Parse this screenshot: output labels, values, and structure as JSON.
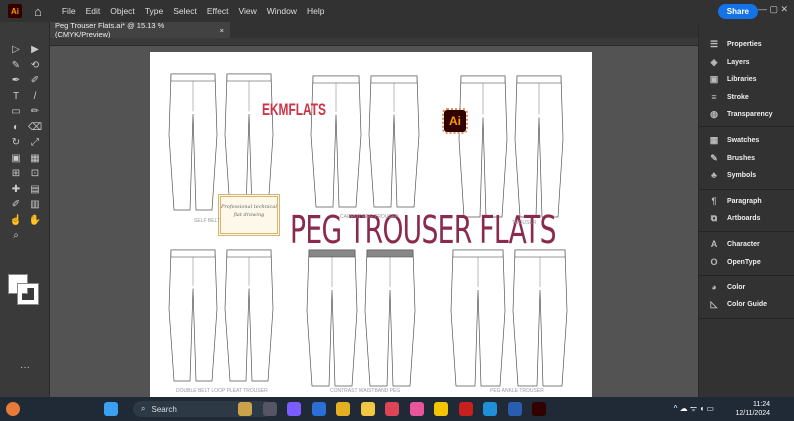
{
  "menubar": {
    "app_icon": "Ai",
    "items": [
      "File",
      "Edit",
      "Object",
      "Type",
      "Select",
      "Effect",
      "View",
      "Window",
      "Help"
    ],
    "share": "Share"
  },
  "document_tab": {
    "title": "Peg Trouser Flats.ai* @ 15.13 % (CMYK/Preview)",
    "close": "×"
  },
  "artwork": {
    "brand": "EKMFLATS",
    "ai_badge": "Ai",
    "title": "PEG TROUSER FLATS",
    "stamp": "Professional technical flat drawing",
    "labels": [
      "SELF BELT",
      "CARROT PEG TROUSER",
      "TROUSER",
      "DOUBLE BELT LOOP PLEAT TROUSER",
      "CONTRAST WAISTBAND PEG",
      "PEG ANKLE TROUSER"
    ]
  },
  "panels": [
    {
      "label": "Properties",
      "icon": "properties-icon"
    },
    {
      "label": "Layers",
      "icon": "layers-icon"
    },
    {
      "label": "Libraries",
      "icon": "libraries-icon"
    },
    {
      "label": "Stroke",
      "icon": "stroke-icon"
    },
    {
      "label": "Transparency",
      "icon": "transparency-icon"
    },
    {
      "label": "Swatches",
      "icon": "swatches-icon"
    },
    {
      "label": "Brushes",
      "icon": "brushes-icon"
    },
    {
      "label": "Symbols",
      "icon": "symbols-icon"
    },
    {
      "label": "Paragraph",
      "icon": "paragraph-icon"
    },
    {
      "label": "Artboards",
      "icon": "artboards-icon"
    },
    {
      "label": "Character",
      "icon": "character-icon"
    },
    {
      "label": "OpenType",
      "icon": "opentype-icon"
    },
    {
      "label": "Color",
      "icon": "color-icon"
    },
    {
      "label": "Color Guide",
      "icon": "color-guide-icon"
    }
  ],
  "taskbar": {
    "search": "Search",
    "time": "11:24",
    "date": "12/11/2024"
  },
  "colors": {
    "accent": "#1473e6",
    "title": "#8b2a4f"
  }
}
